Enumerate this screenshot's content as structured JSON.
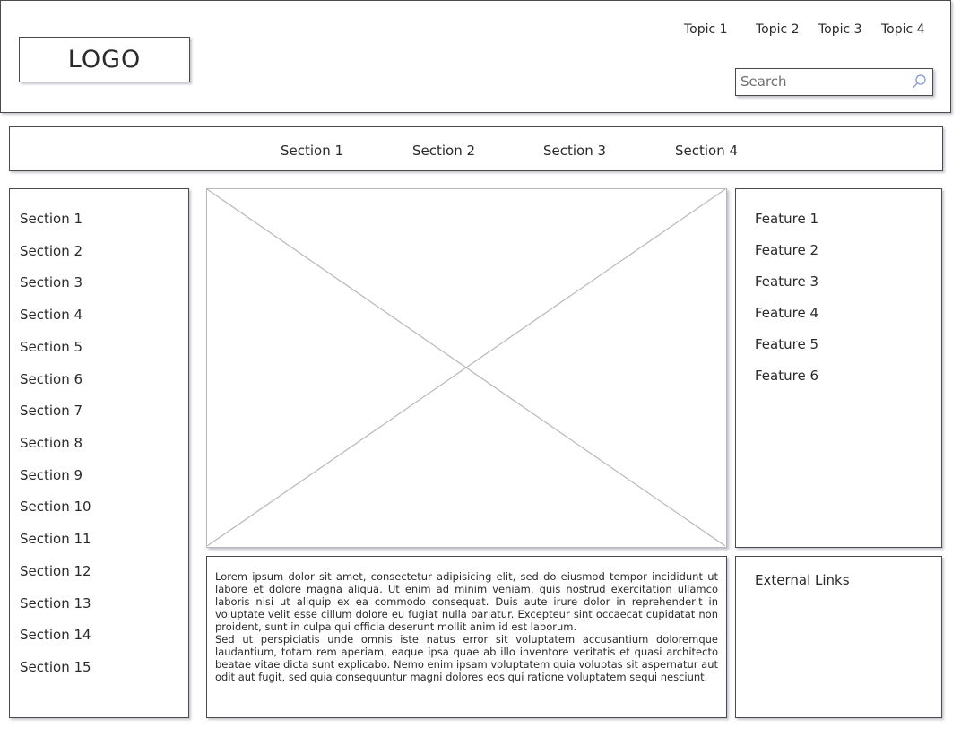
{
  "header": {
    "logo_text": "LOGO",
    "topics": [
      "Topic 1",
      "Topic 2",
      "Topic 3",
      "Topic 4"
    ],
    "search": {
      "placeholder": "Search",
      "value": ""
    }
  },
  "nav": {
    "sections": [
      "Section 1",
      "Section 2",
      "Section 3",
      "Section 4"
    ]
  },
  "sidebar": {
    "items": [
      "Section 1",
      "Section 2",
      "Section 3",
      "Section 4",
      "Section 5",
      "Section 6",
      "Section 7",
      "Section 8",
      "Section 9",
      "Section 10",
      "Section 11",
      "Section 12",
      "Section 13",
      "Section 14",
      "Section 15"
    ]
  },
  "content": {
    "paragraphs": [
      "Lorem ipsum dolor sit amet, consectetur adipisicing elit, sed do eiusmod tempor incididunt ut labore et dolore magna aliqua. Ut enim ad minim veniam, quis nostrud exercitation ullamco laboris nisi ut aliquip ex ea commodo consequat. Duis aute irure dolor in reprehenderit in voluptate velit esse cillum dolore eu fugiat nulla pariatur. Excepteur sint occaecat cupidatat non proident, sunt in culpa qui officia deserunt mollit anim id est laborum.",
      "Sed ut perspiciatis unde omnis iste natus error sit voluptatem accusantium doloremque laudantium, totam rem aperiam, eaque ipsa quae ab illo inventore veritatis et quasi architecto beatae vitae dicta sunt explicabo. Nemo enim ipsam voluptatem quia voluptas sit aspernatur aut odit aut fugit, sed quia consequuntur magni dolores eos qui ratione voluptatem sequi nesciunt."
    ]
  },
  "features": {
    "items": [
      "Feature 1",
      "Feature 2",
      "Feature 3",
      "Feature 4",
      "Feature 5",
      "Feature 6"
    ]
  },
  "external_links": {
    "title": "External Links"
  },
  "icons": {
    "search": "search-icon",
    "image_placeholder": "image-placeholder"
  },
  "colors": {
    "border": "#4a4a4a",
    "text": "#2a2a2a",
    "search_icon": "#7f96d8",
    "placeholder_lines": "#b8b8b8"
  }
}
